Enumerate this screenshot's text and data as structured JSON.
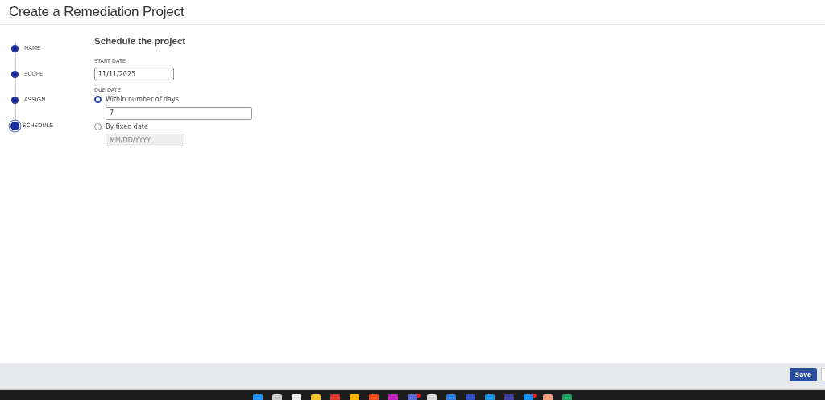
{
  "page": {
    "title": "Create a Remediation Project"
  },
  "steps": [
    {
      "label": "NAME",
      "selected": false
    },
    {
      "label": "SCOPE",
      "selected": false
    },
    {
      "label": "ASSIGN",
      "selected": false
    },
    {
      "label": "SCHEDULE",
      "selected": true
    }
  ],
  "form": {
    "heading": "Schedule the project",
    "start_date": {
      "label": "START DATE",
      "value": "11/11/2025"
    },
    "due_date": {
      "label": "DUE DATE",
      "options": [
        {
          "label": "Within number of days",
          "selected": true,
          "kind": "number",
          "value": "7",
          "disabled": false
        },
        {
          "label": "By fixed date",
          "selected": false,
          "kind": "date",
          "placeholder": "MM/DD/YYYY",
          "disabled": true
        }
      ]
    }
  },
  "footer": {
    "buttons": [
      "Save"
    ]
  },
  "taskbar": {
    "icons": [
      {
        "color": "#1e90ff"
      },
      {
        "color": "#cccccc"
      },
      {
        "color": "#eeeeee"
      },
      {
        "color": "#f2c230"
      },
      {
        "color": "#e03a2e"
      },
      {
        "color": "#f5b400"
      },
      {
        "color": "#f04a1a"
      },
      {
        "color": "#c020c0"
      },
      {
        "color": "#5a6cd0",
        "badge": true
      },
      {
        "color": "#dddddd"
      },
      {
        "color": "#2a7de1"
      },
      {
        "color": "#3050c0"
      },
      {
        "color": "#1a90e0"
      },
      {
        "color": "#4040a0"
      },
      {
        "color": "#1090f0",
        "badge": true
      },
      {
        "color": "#f0a080"
      },
      {
        "color": "#20a060"
      }
    ]
  }
}
